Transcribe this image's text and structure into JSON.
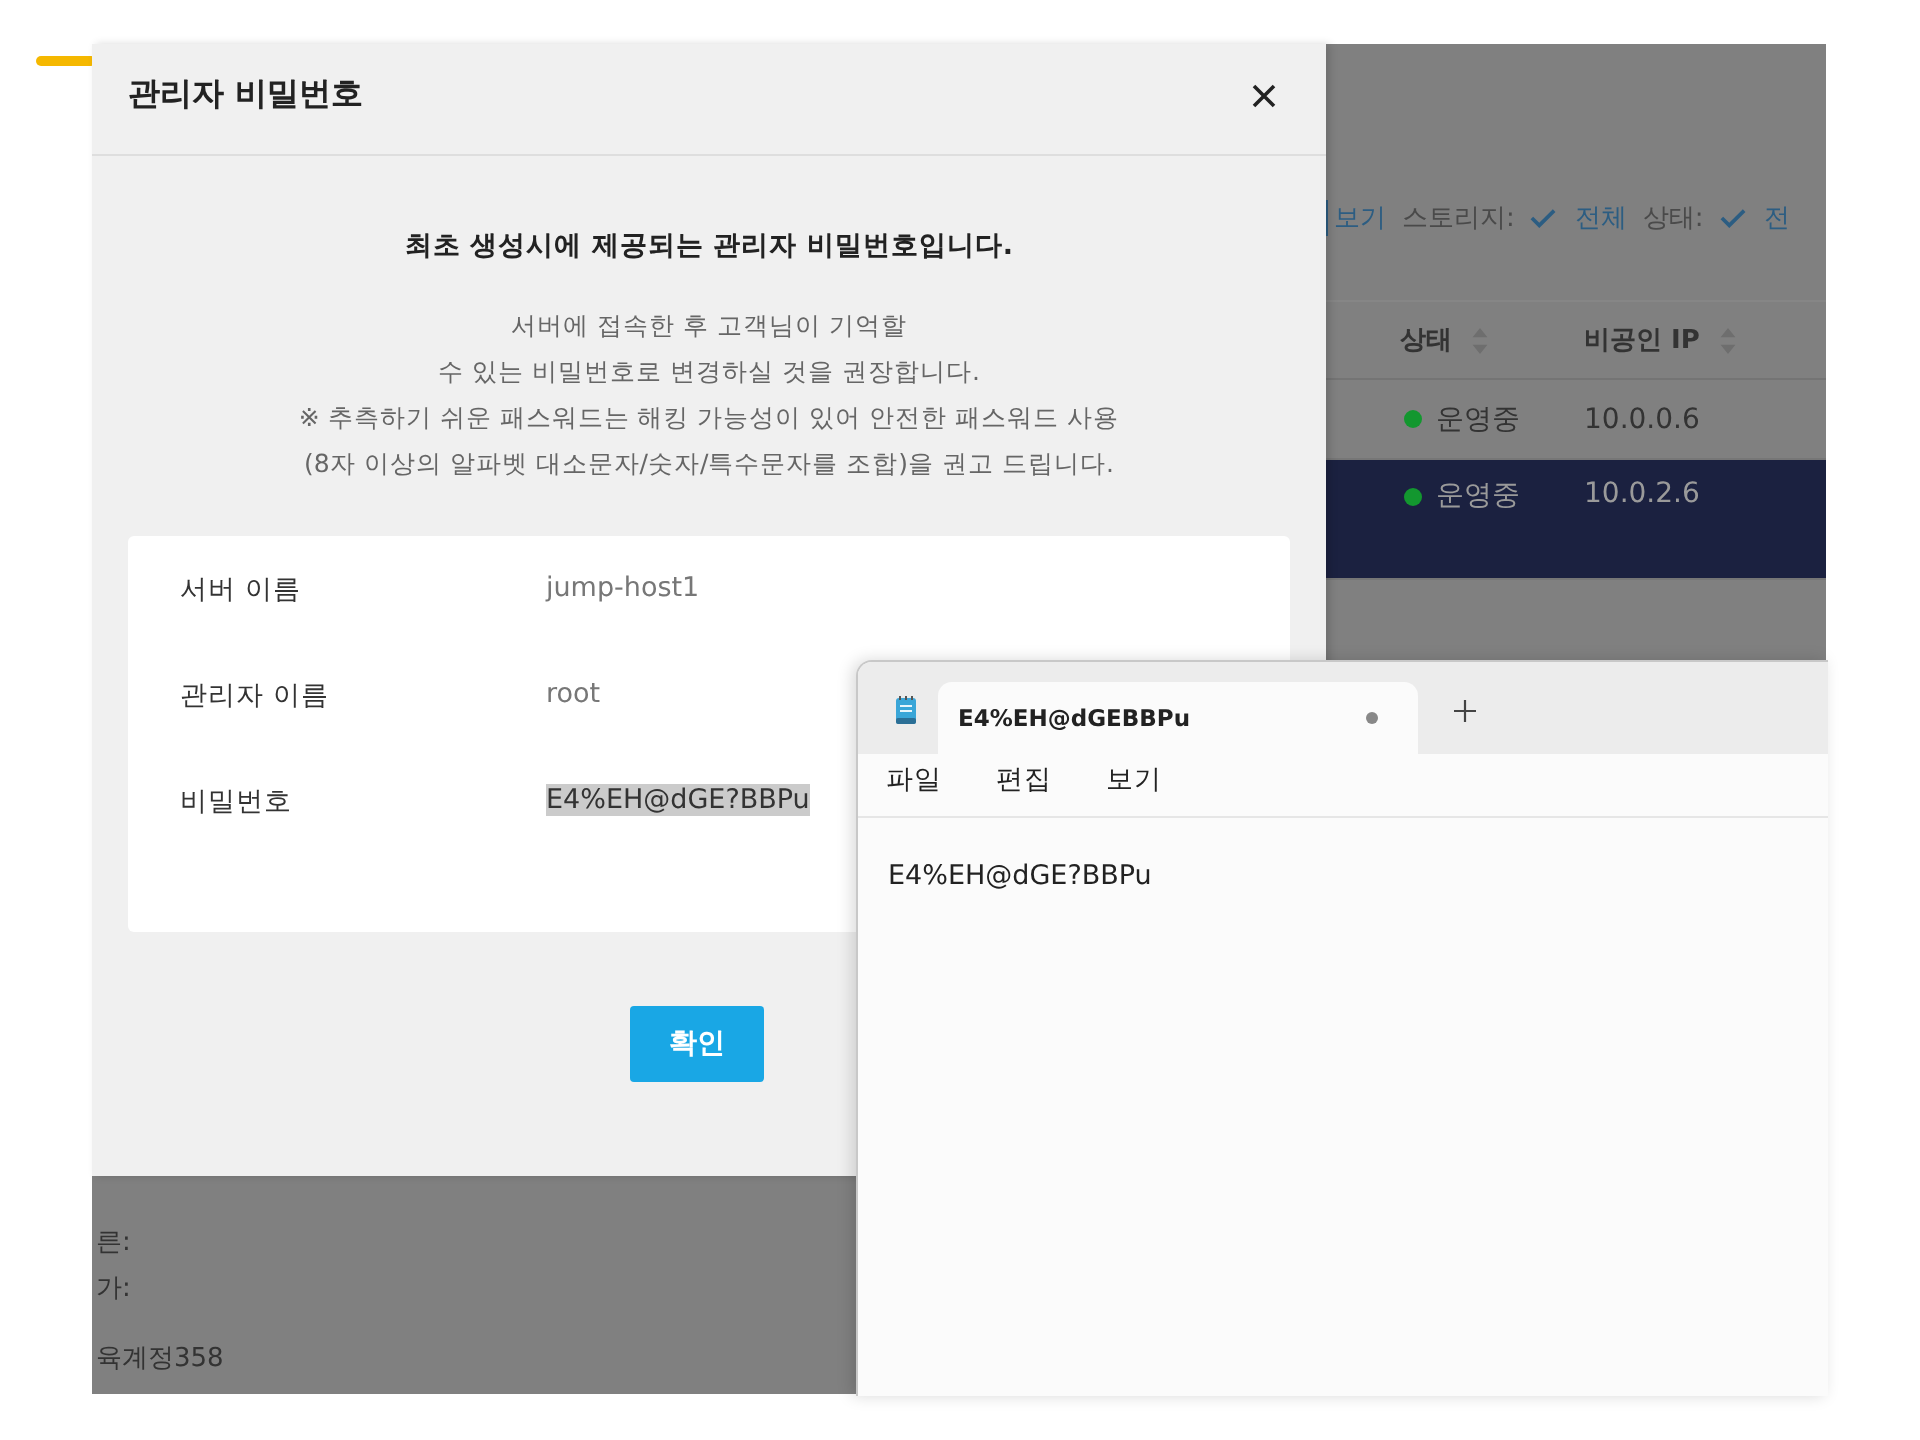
{
  "background": {
    "filter_bar": [
      {
        "kind": "link",
        "text": "보기"
      },
      {
        "kind": "label",
        "text": "스토리지:"
      },
      {
        "kind": "check",
        "text": "전체"
      },
      {
        "kind": "label",
        "text": "상태:"
      },
      {
        "kind": "check",
        "text": "전"
      }
    ],
    "table": {
      "columns": [
        "상태",
        "비공인 IP"
      ],
      "rows": [
        {
          "status": "운영중",
          "ip": "10.0.0.6",
          "selected": false
        },
        {
          "status": "운영중",
          "ip": "10.0.2.6",
          "selected": true
        }
      ]
    },
    "details": [
      "른:",
      "가:",
      "육계정358"
    ]
  },
  "dialog": {
    "title": "관리자 비밀번호",
    "heading": "최초 생성시에 제공되는 관리자 비밀번호입니다.",
    "message": [
      "서버에 접속한 후 고객님이 기억할",
      "수 있는 비밀번호로 변경하실 것을 권장합니다.",
      "※ 추측하기 쉬운 패스워드는 해킹 가능성이 있어 안전한 패스워드 사용",
      "(8자 이상의 알파벳 대소문자/숫자/특수문자를 조합)을 권고 드립니다."
    ],
    "fields": [
      {
        "label": "서버 이름",
        "value": "jump-host1",
        "highlighted": false
      },
      {
        "label": "관리자 이름",
        "value": "root",
        "highlighted": false
      },
      {
        "label": "비밀번호",
        "value": "E4%EH@dGE?BBPu",
        "highlighted": true
      }
    ],
    "confirm": "확인"
  },
  "notepad": {
    "tab": {
      "title": "E4%EH@dGEBBPu",
      "unsaved": true
    },
    "menu": [
      "파일",
      "편집",
      "보기"
    ],
    "content": "E4%EH@dGE?BBPu"
  }
}
